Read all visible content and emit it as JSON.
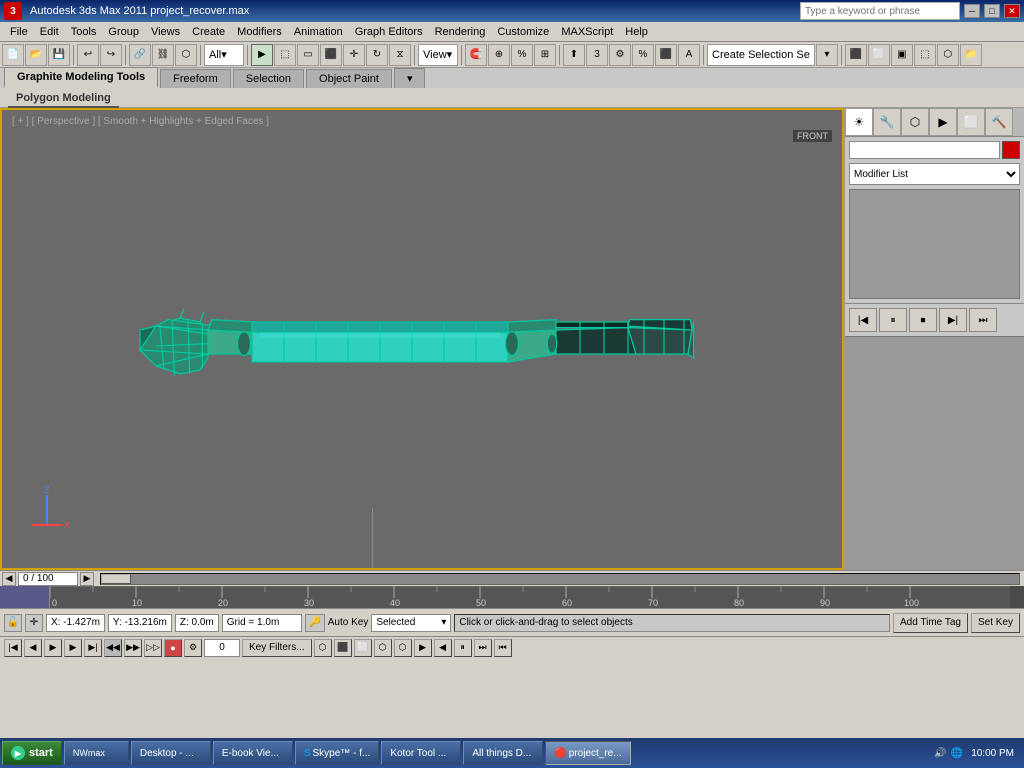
{
  "app": {
    "title": "Autodesk 3ds Max 2011",
    "filename": "project_recover.max",
    "version": "2011"
  },
  "titlebar": {
    "title": "Autodesk 3ds Max 2011    project_recover.max",
    "search_placeholder": "Type a keyword or phrase",
    "minimize": "─",
    "maximize": "□",
    "close": "✕"
  },
  "menubar": {
    "items": [
      "File",
      "Edit",
      "Tools",
      "Group",
      "Views",
      "Create",
      "Modifiers",
      "Animation",
      "Graph Editors",
      "Rendering",
      "Customize",
      "MAXScript",
      "Help"
    ]
  },
  "toolbar": {
    "all_label": "All",
    "view_label": "View",
    "create_selection_set": "Create Selection Se"
  },
  "ribbon": {
    "tabs": [
      "Graphite Modeling Tools",
      "Freeform",
      "Selection",
      "Object Paint"
    ],
    "active_tab": "Graphite Modeling Tools",
    "sub_tabs": [
      "Polygon Modeling"
    ]
  },
  "viewport": {
    "label": "[ + ] [ Perspective ] [ Smooth + Highlights + Edged Faces ]",
    "corner_label": "FRONT"
  },
  "right_panel": {
    "modifier_list_label": "Modifier List",
    "color": "#cc0000"
  },
  "timeline": {
    "counter": "0 / 100",
    "ticks": [
      0,
      10,
      20,
      30,
      40,
      50,
      60,
      70,
      80,
      90,
      100
    ],
    "start": 0,
    "end": 100
  },
  "statusbar": {
    "x_value": "X: -1.427m",
    "y_value": "Y: -13.216m",
    "z_value": "Z: 0.0m",
    "grid_value": "Grid = 1.0m",
    "status_text": "Click or click-and-drag to select objects",
    "add_time_tag": "Add Time Tag",
    "set_key": "Set Key",
    "auto_key": "Auto Key",
    "selected_label": "Selected",
    "key_filters": "Key Filters...",
    "frame_value": "0"
  },
  "taskbar": {
    "start": "start",
    "items": [
      "NWmax",
      "Desktop - ...",
      "E-book Vie...",
      "Skype™ - f...",
      "Kotor Tool ...",
      "All things D...",
      "project_re..."
    ],
    "active_item": "project_re...",
    "clock": "10:00 PM"
  }
}
